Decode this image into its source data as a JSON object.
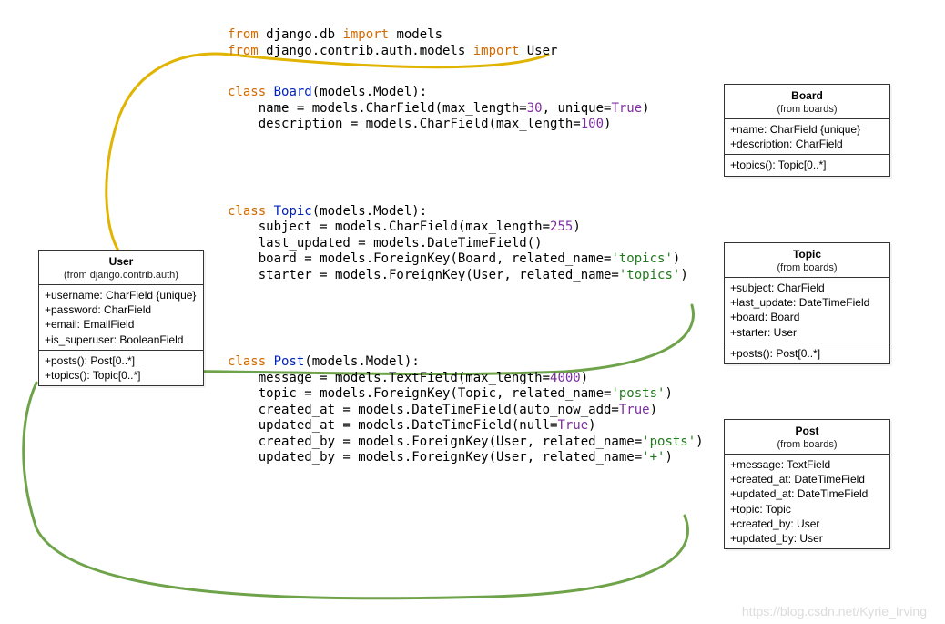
{
  "watermark": "https://blog.csdn.net/Kyrie_Irving",
  "code": {
    "import1_prefix": "from",
    "import1_mid": " django.db ",
    "import1_import": "import",
    "import1_target": " models",
    "import2_prefix": "from",
    "import2_mid": " django.contrib.auth.models ",
    "import2_import": "import",
    "import2_target": " User",
    "class_kw": "class",
    "board_cls": " Board",
    "board_sig": "(models.Model):",
    "board_name_line_a": "    name = models.CharField(max_length=",
    "board_name_line_b": "30",
    "board_name_line_c": ", unique=",
    "board_name_line_d": "True",
    "board_name_line_e": ")",
    "board_desc_line_a": "    description = models.CharField(max_length=",
    "board_desc_line_b": "100",
    "board_desc_line_c": ")",
    "topic_cls": " Topic",
    "topic_sig": "(models.Model):",
    "topic_subject_a": "    subject = models.CharField(max_length=",
    "topic_subject_b": "255",
    "topic_subject_c": ")",
    "topic_last": "    last_updated = models.DateTimeField()",
    "topic_board_a": "    board = models.ForeignKey(Board, related_name=",
    "topic_board_b": "'topics'",
    "topic_board_c": ")",
    "topic_starter_a": "    starter = models.ForeignKey(User, related_name=",
    "topic_starter_b": "'topics'",
    "topic_starter_c": ")",
    "post_cls": " Post",
    "post_sig": "(models.Model):",
    "post_msg_a": "    message = models.TextField(max_length=",
    "post_msg_b": "4000",
    "post_msg_c": ")",
    "post_topic_a": "    topic = models.ForeignKey(Topic, related_name=",
    "post_topic_b": "'posts'",
    "post_topic_c": ")",
    "post_created_a": "    created_at = models.DateTimeField(auto_now_add=",
    "post_created_b": "True",
    "post_created_c": ")",
    "post_updated_a": "    updated_at = models.DateTimeField(null=",
    "post_updated_b": "True",
    "post_updated_c": ")",
    "post_cby_a": "    created_by = models.ForeignKey(User, related_name=",
    "post_cby_b": "'posts'",
    "post_cby_c": ")",
    "post_uby_a": "    updated_by = models.ForeignKey(User, related_name=",
    "post_uby_b": "'+'",
    "post_uby_c": ")"
  },
  "uml": {
    "board": {
      "name": "Board",
      "from": "(from boards)",
      "attrs": [
        "+name: CharField {unique}",
        "+description: CharField"
      ],
      "ops": [
        "+topics(): Topic[0..*]"
      ]
    },
    "topic": {
      "name": "Topic",
      "from": "(from boards)",
      "attrs": [
        "+subject: CharField",
        "+last_update: DateTimeField",
        "+board: Board",
        "+starter: User"
      ],
      "ops": [
        "+posts(): Post[0..*]"
      ]
    },
    "post": {
      "name": "Post",
      "from": "(from boards)",
      "attrs": [
        "+message: TextField",
        "+created_at: DateTimeField",
        "+updated_at: DateTimeField",
        "+topic: Topic",
        "+created_by: User",
        "+updated_by: User"
      ],
      "ops": []
    },
    "user": {
      "name": "User",
      "from": "(from django.contrib.auth)",
      "attrs": [
        "+username: CharField {unique}",
        "+password: CharField",
        "+email: EmailField",
        "+is_superuser: BooleanField"
      ],
      "ops": [
        "+posts(): Post[0..*]",
        "+topics(): Topic[0..*]"
      ]
    }
  },
  "chart_data": {
    "type": "diagram",
    "description": "Django models.py code alongside UML class boxes with hand-drawn connectors",
    "classes": [
      {
        "name": "Board",
        "module": "boards",
        "fields": [
          {
            "name": "name",
            "type": "CharField",
            "unique": true,
            "max_length": 30
          },
          {
            "name": "description",
            "type": "CharField",
            "max_length": 100
          }
        ],
        "related": [
          {
            "name": "topics",
            "type": "Topic[0..*]"
          }
        ]
      },
      {
        "name": "Topic",
        "module": "boards",
        "fields": [
          {
            "name": "subject",
            "type": "CharField",
            "max_length": 255
          },
          {
            "name": "last_updated",
            "type": "DateTimeField"
          },
          {
            "name": "board",
            "type": "ForeignKey(Board)",
            "related_name": "topics"
          },
          {
            "name": "starter",
            "type": "ForeignKey(User)",
            "related_name": "topics"
          }
        ],
        "related": [
          {
            "name": "posts",
            "type": "Post[0..*]"
          }
        ]
      },
      {
        "name": "Post",
        "module": "boards",
        "fields": [
          {
            "name": "message",
            "type": "TextField",
            "max_length": 4000
          },
          {
            "name": "topic",
            "type": "ForeignKey(Topic)",
            "related_name": "posts"
          },
          {
            "name": "created_at",
            "type": "DateTimeField",
            "auto_now_add": true
          },
          {
            "name": "updated_at",
            "type": "DateTimeField",
            "null": true
          },
          {
            "name": "created_by",
            "type": "ForeignKey(User)",
            "related_name": "posts"
          },
          {
            "name": "updated_by",
            "type": "ForeignKey(User)",
            "related_name": "+"
          }
        ]
      },
      {
        "name": "User",
        "module": "django.contrib.auth",
        "fields": [
          {
            "name": "username",
            "type": "CharField",
            "unique": true
          },
          {
            "name": "password",
            "type": "CharField"
          },
          {
            "name": "email",
            "type": "EmailField"
          },
          {
            "name": "is_superuser",
            "type": "BooleanField"
          }
        ],
        "related": [
          {
            "name": "posts",
            "type": "Post[0..*]"
          },
          {
            "name": "topics",
            "type": "Topic[0..*]"
          }
        ]
      }
    ],
    "connectors": [
      {
        "color": "#e0b400",
        "from": "import User",
        "to": "User UML box"
      },
      {
        "color": "#6ea34a",
        "from": "Topic.starter related_name='topics'",
        "to": "User.topics()"
      },
      {
        "color": "#6ea34a",
        "from": "Post.created_by related_name='posts'",
        "to": "User.posts()"
      }
    ]
  }
}
